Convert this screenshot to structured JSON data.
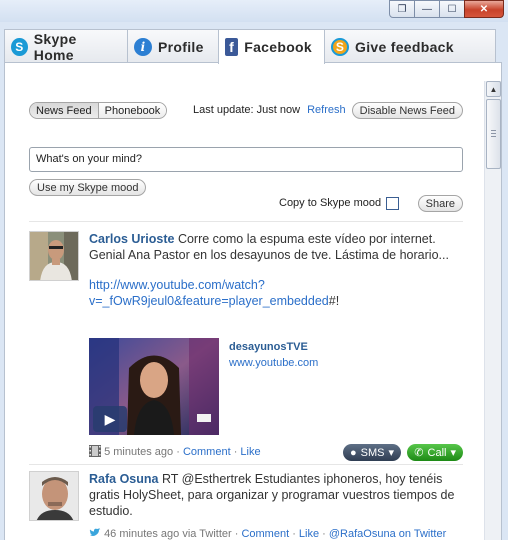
{
  "tabs": [
    {
      "label": "Skype Home",
      "icon": "skype-icon"
    },
    {
      "label": "Profile",
      "icon": "info-icon"
    },
    {
      "label": "Facebook",
      "icon": "facebook-icon"
    },
    {
      "label": "Give feedback",
      "icon": "skype-feedback-icon"
    }
  ],
  "feed": {
    "toggle": {
      "news_feed": "News Feed",
      "phonebook": "Phonebook"
    },
    "last_update_label": "Last update: Just now",
    "refresh_label": "Refresh",
    "disable_label": "Disable News Feed",
    "status_value": "What's on your mind?",
    "mood_button": "Use my Skype mood",
    "copy_label": "Copy to Skype mood",
    "share_button": "Share"
  },
  "posts": [
    {
      "author": "Carlos Urioste",
      "text": "Corre como la espuma este vídeo por internet. Genial Ana Pastor en los desayunos de tve. Lástima de horario...",
      "link_line1": "http://www.youtube.com/watch?",
      "link_line2": "v=_fOwR9jeul0&feature=player_embedded",
      "link_suffix": "#!",
      "video_title": "desayunosTVE",
      "video_url": "www.youtube.com",
      "time": "5 minutes ago",
      "comment": "Comment",
      "like": "Like",
      "sms": "SMS",
      "call": "Call"
    },
    {
      "author": "Rafa Osuna",
      "text": "RT @Esthertrek Estudiantes iphoneros, hoy tenéis gratis HolySheet, para organizar y programar vuestros tiempos de estudio.",
      "time": "46 minutes ago",
      "via": "via",
      "source": "Twitter",
      "comment": "Comment",
      "like": "Like",
      "twitter_link": "@RafaOsuna on Twitter"
    }
  ]
}
